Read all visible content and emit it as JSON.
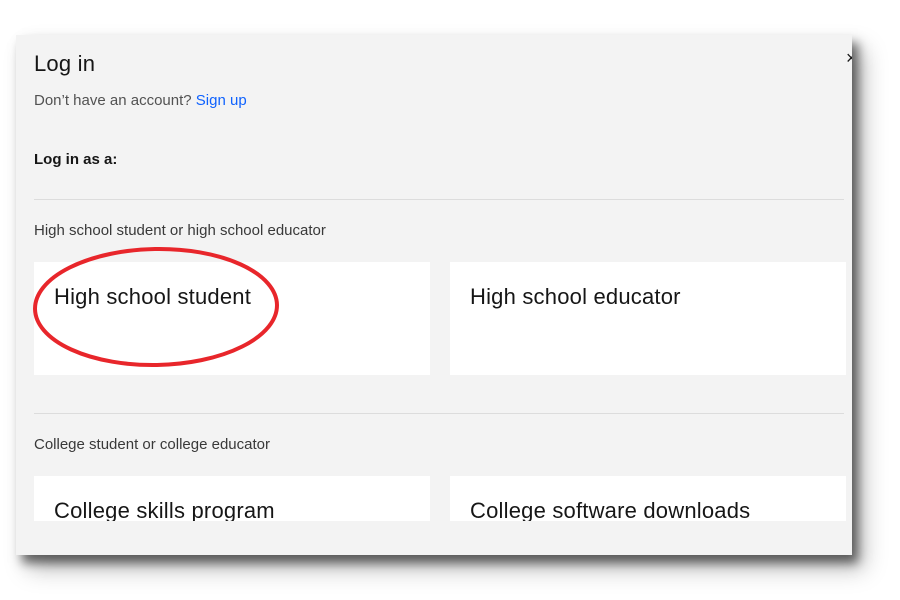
{
  "modal": {
    "close_label": "×",
    "title": "Log in",
    "no_account_text": "Don’t have an account?",
    "signup_link": "Sign up",
    "login_as_label": "Log in as a:",
    "sections": [
      {
        "label": "High school student or high school educator",
        "tiles": [
          {
            "label": "High school student"
          },
          {
            "label": "High school educator"
          }
        ]
      },
      {
        "label": "College student or college educator",
        "tiles": [
          {
            "label": "College skills program"
          },
          {
            "label": "College software downloads"
          }
        ]
      }
    ]
  },
  "annotation": {
    "highlight_color": "#e8262b",
    "highlighted_item": "High school student"
  },
  "colors": {
    "modal_bg": "#f3f3f3",
    "tile_bg": "#ffffff",
    "link": "#0f62fe",
    "text": "#161616"
  }
}
